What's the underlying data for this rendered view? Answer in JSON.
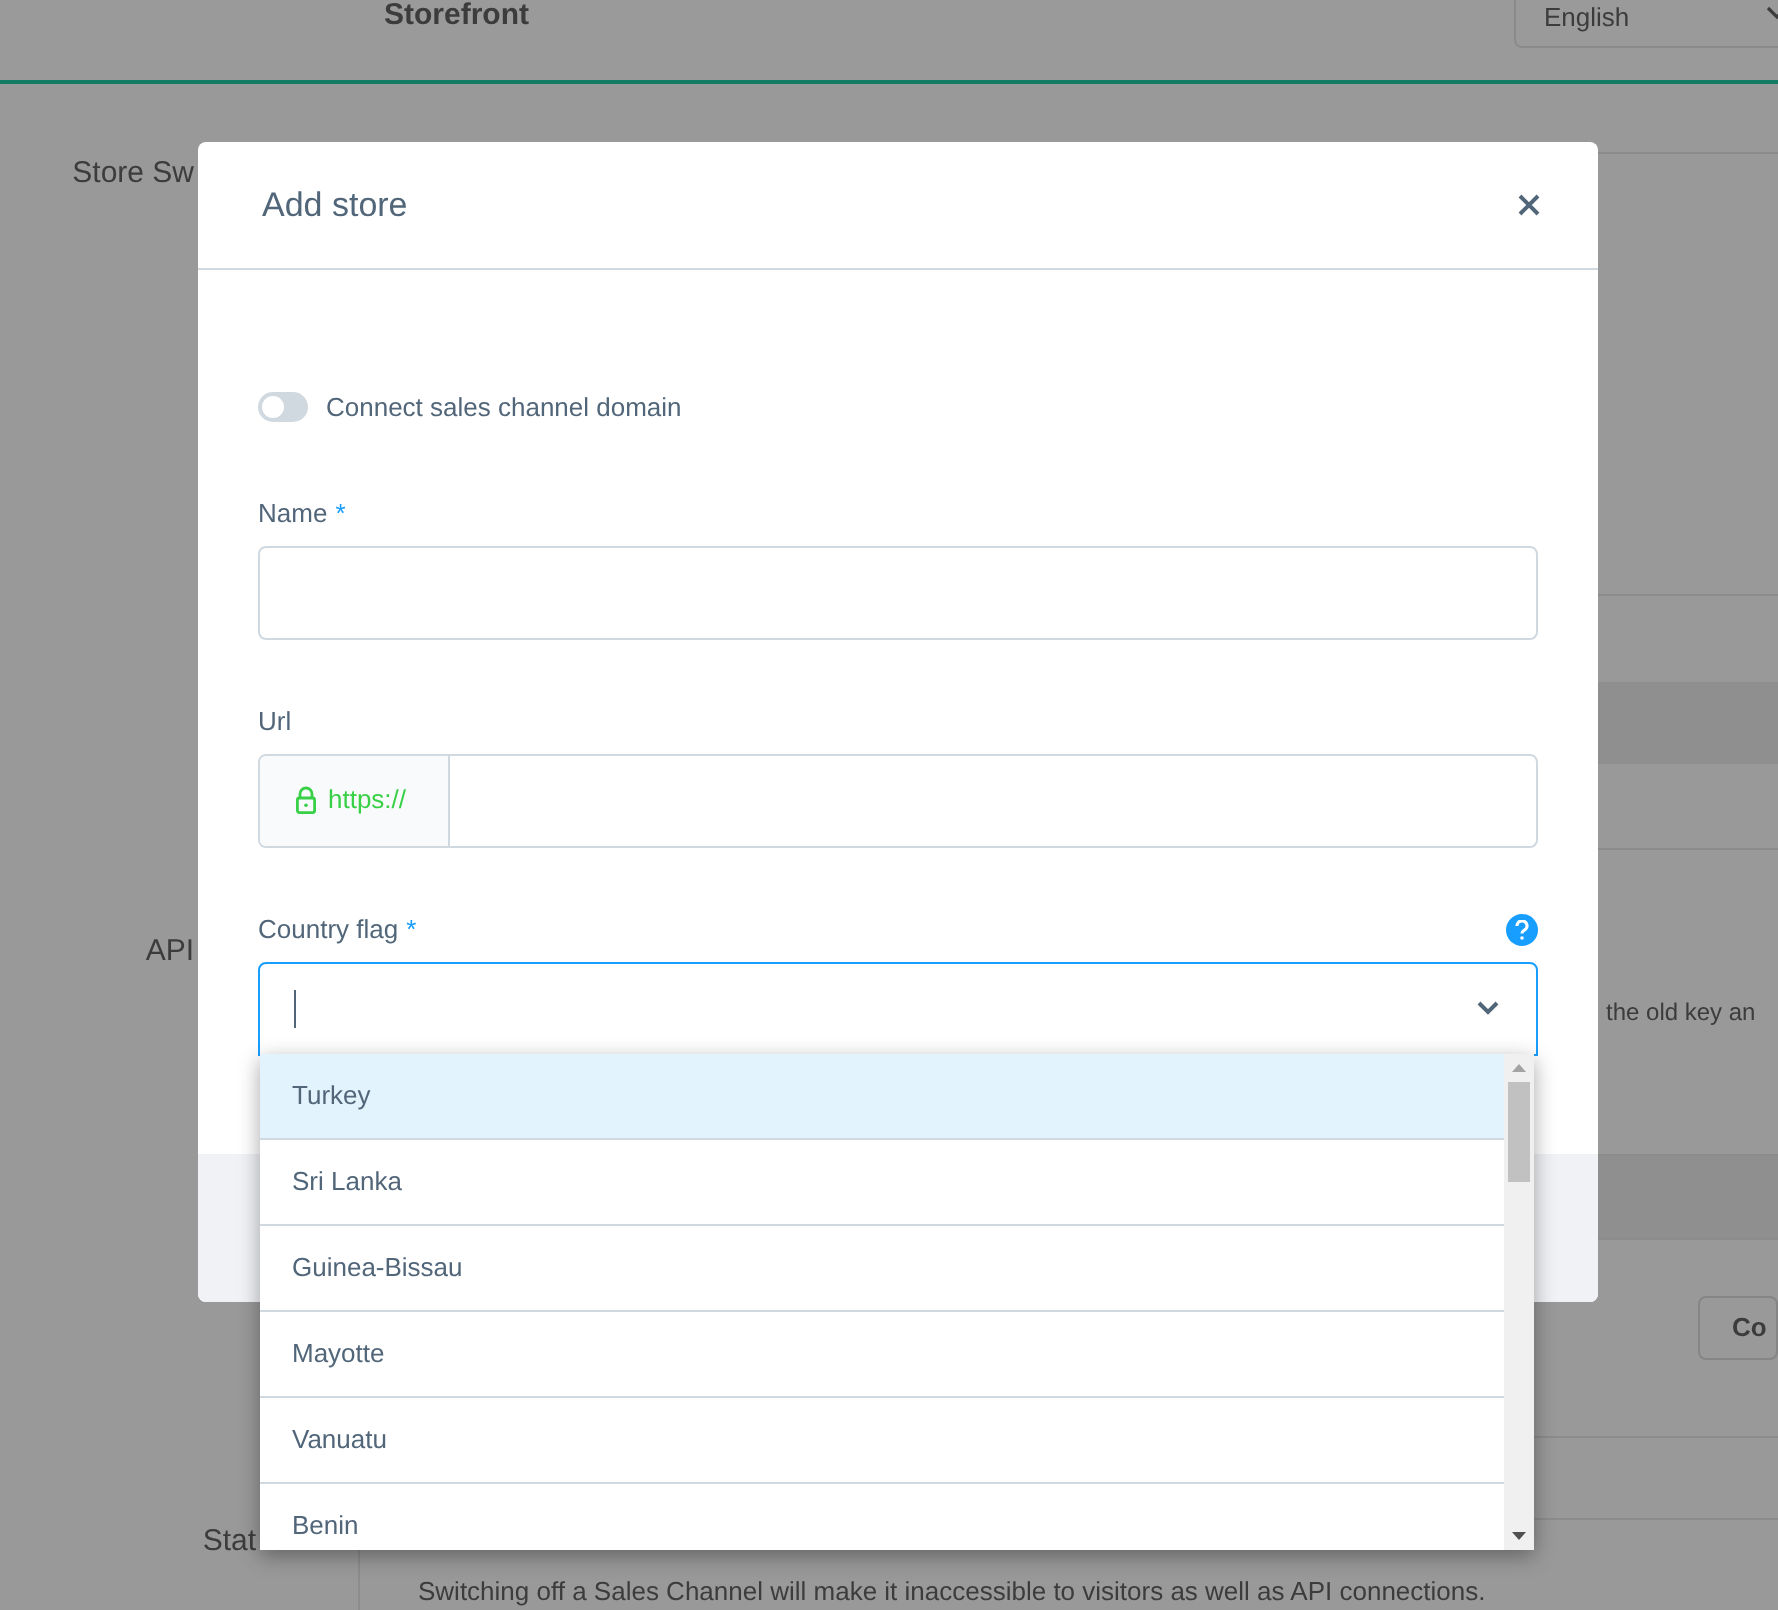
{
  "header": {
    "title": "Storefront",
    "language": "English"
  },
  "page": {
    "store_label": "Store Sw",
    "api_label": "API",
    "status_label": "Stat",
    "snippet": "the old key an",
    "button": "Co",
    "note": "Switching off a Sales Channel will make it inaccessible to visitors as well as API connections."
  },
  "modal": {
    "title": "Add store",
    "toggle": {
      "label": "Connect sales channel domain",
      "on": false
    },
    "fields": [
      {
        "kind": "text",
        "label": "Name",
        "required_mark": "*"
      },
      {
        "kind": "url",
        "label": "Url",
        "prefix": "https://"
      },
      {
        "kind": "select",
        "label": "Country flag",
        "required_mark": "*",
        "help": true,
        "focused": true
      }
    ],
    "options": [
      {
        "label": "Turkey",
        "selected": true
      },
      {
        "label": "Sri Lanka",
        "selected": false
      },
      {
        "label": "Guinea-Bissau",
        "selected": false
      },
      {
        "label": "Mayotte",
        "selected": false
      },
      {
        "label": "Vanuatu",
        "selected": false
      },
      {
        "label": "Benin",
        "selected": false
      }
    ]
  }
}
